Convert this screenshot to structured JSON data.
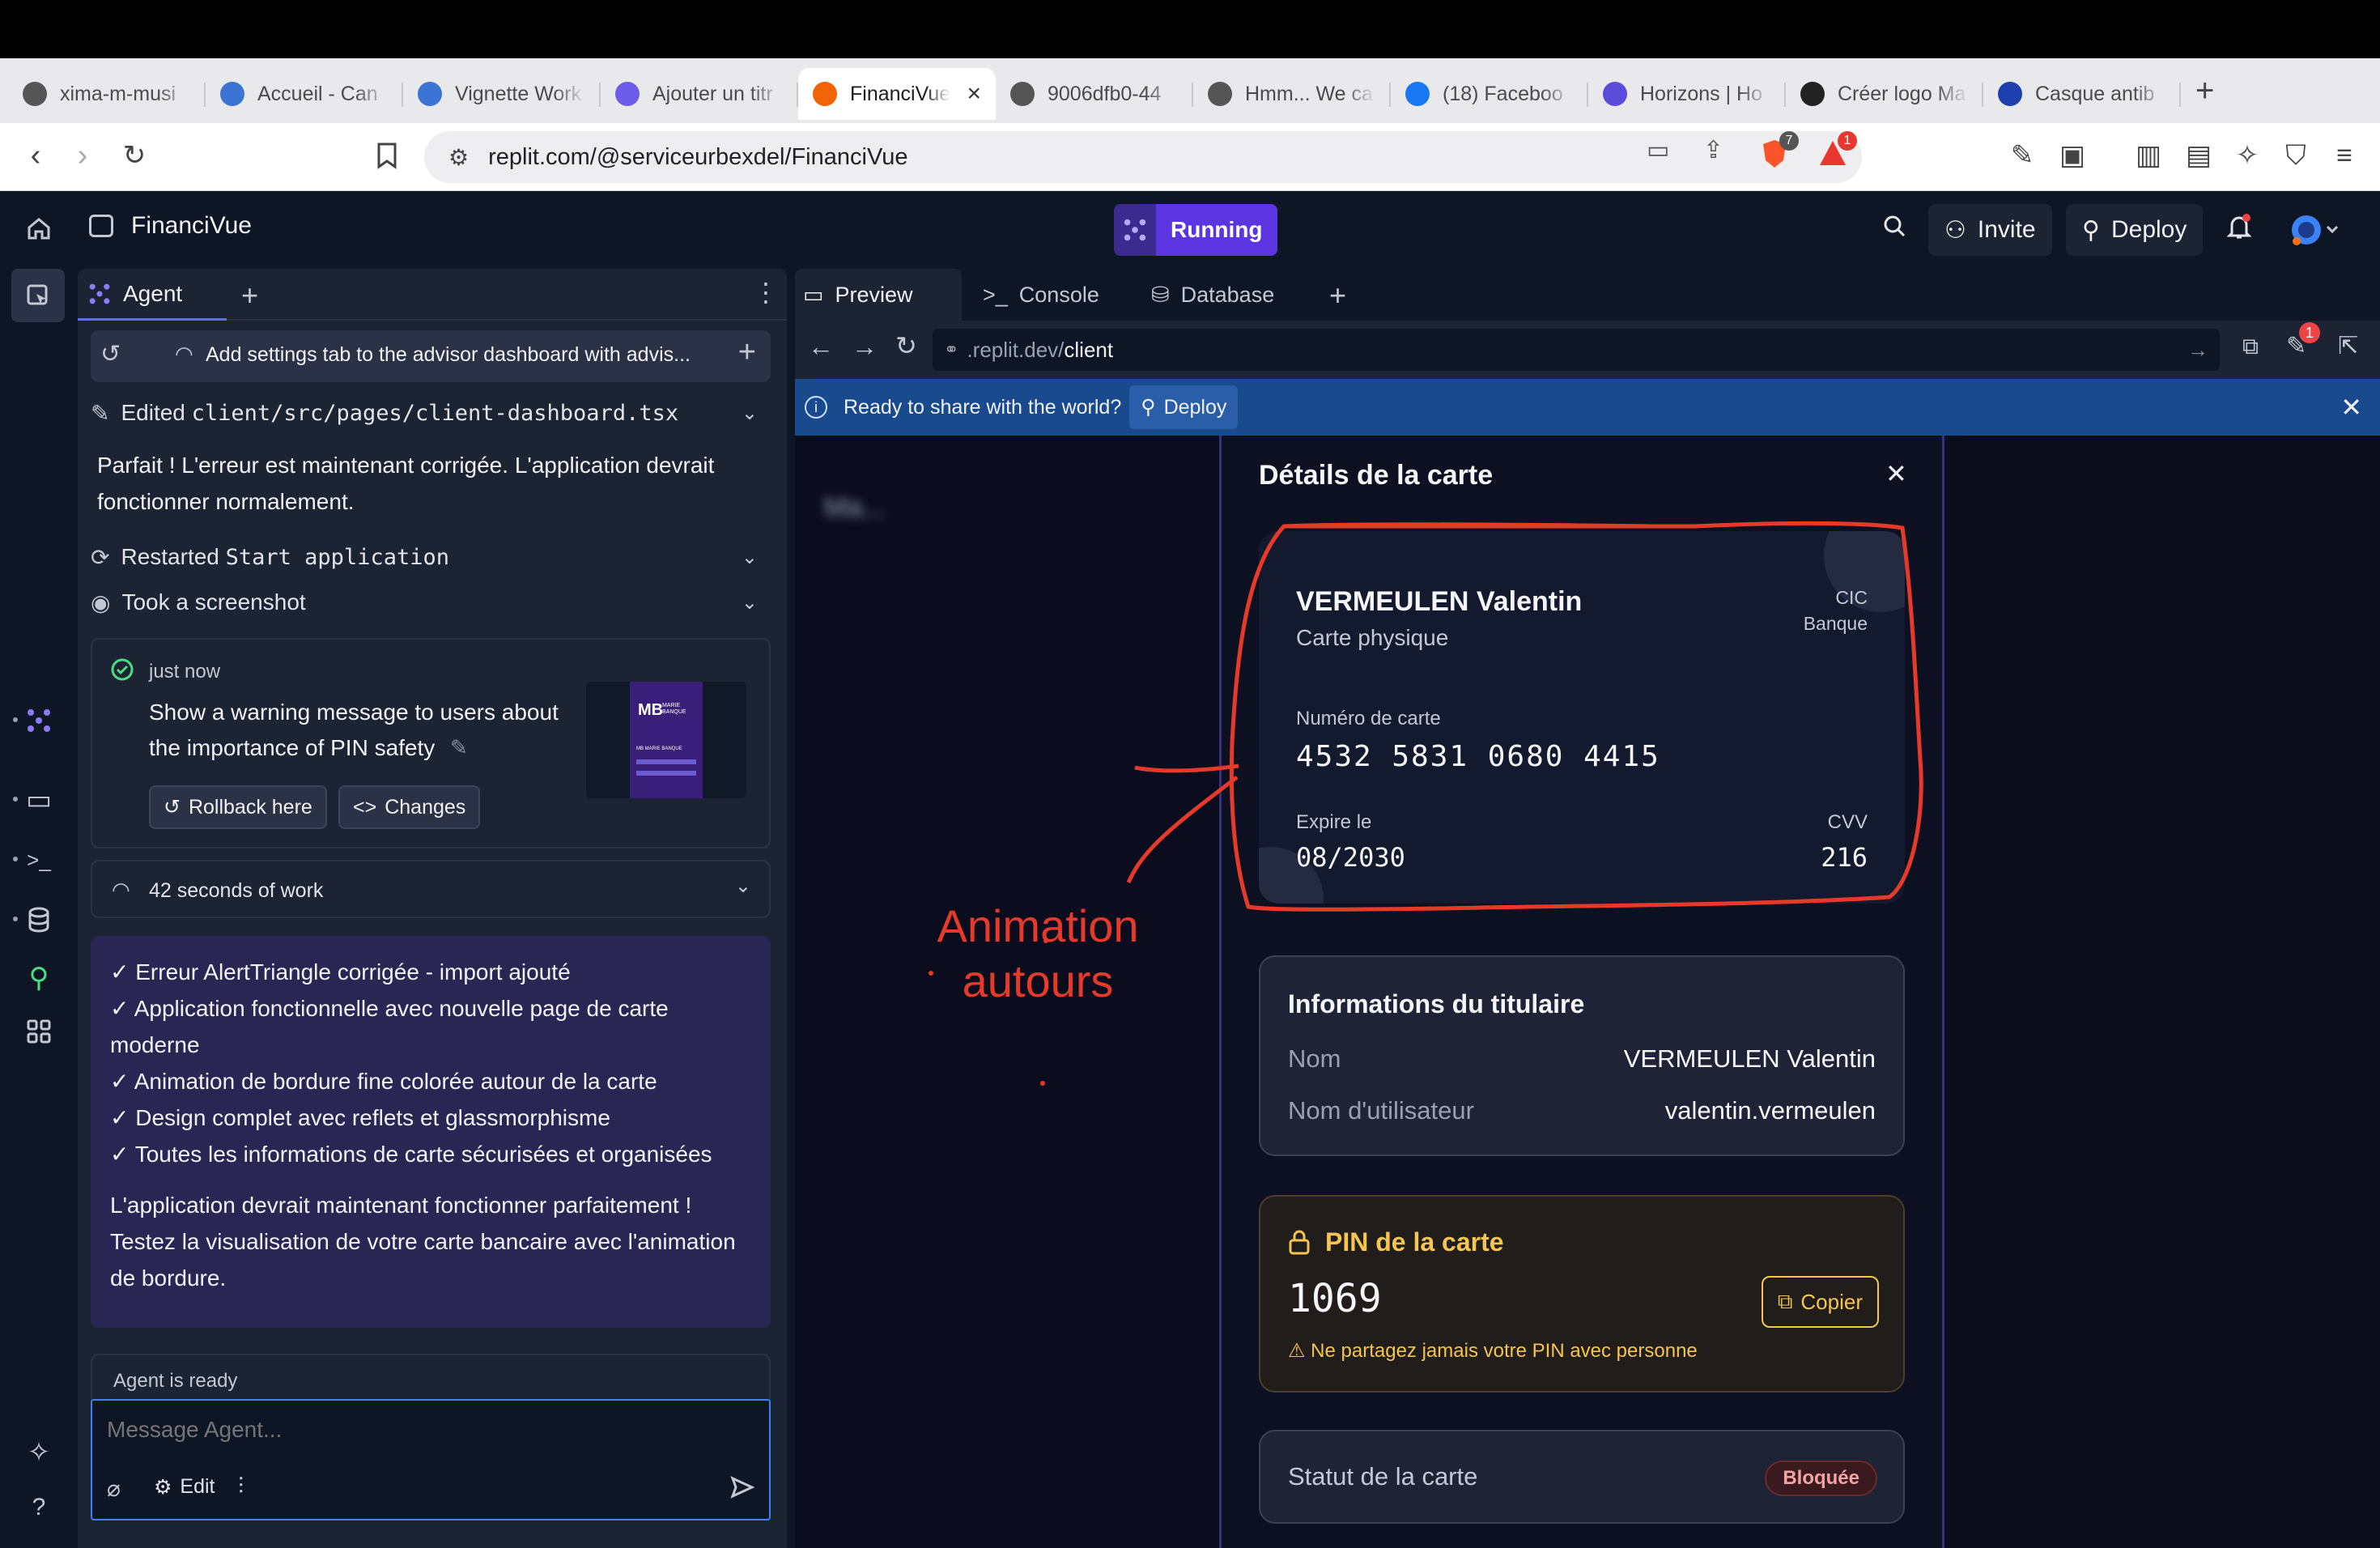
{
  "browser": {
    "tabs": [
      {
        "label": "xima-m-musi",
        "icon": "globe-icon",
        "color": "#555"
      },
      {
        "label": "Accueil - Can",
        "icon": "canva-icon",
        "color": "#3b74d4"
      },
      {
        "label": "Vignette Work",
        "icon": "canva-icon",
        "color": "#3b74d4"
      },
      {
        "label": "Ajouter un titr",
        "icon": "badge-icon",
        "color": "#6c5ce7"
      },
      {
        "label": "FinanciVue",
        "icon": "replit-icon",
        "color": "#f26207",
        "active": true
      },
      {
        "label": "9006dfb0-44",
        "icon": "globe-icon",
        "color": "#555"
      },
      {
        "label": "Hmm... We ca",
        "icon": "globe-icon",
        "color": "#555"
      },
      {
        "label": "(18) Faceboo",
        "icon": "facebook-icon",
        "color": "#1877f2"
      },
      {
        "label": "Horizons | Ho",
        "icon": "horizons-icon",
        "color": "#5b4bdb"
      },
      {
        "label": "Créer logo Ma",
        "icon": "openai-icon",
        "color": "#222"
      },
      {
        "label": "Casque antib",
        "icon": "brand-a-icon",
        "color": "#1e40af"
      }
    ],
    "url": "replit.com/@serviceurbexdel/FinanciVue",
    "brave_badge": "7",
    "rewards_badge": "1"
  },
  "topbar": {
    "project": "FinanciVue",
    "status": "Running",
    "invite": "Invite",
    "deploy": "Deploy"
  },
  "agent": {
    "tab_label": "Agent",
    "task_title": "Add settings tab to the advisor dashboard with advis...",
    "edited_prefix": "Edited ",
    "edited_file": "client/src/pages/client-dashboard.tsx",
    "message": "Parfait ! L'erreur est maintenant corrigée. L'application devrait fonctionner normalement.",
    "restarted_prefix": "Restarted ",
    "restarted_name": "Start application",
    "screenshot": "Took a screenshot",
    "checkpoint": {
      "time": "just now",
      "text": "Show a warning message to users about the importance of PIN safety",
      "rollback": "Rollback here",
      "changes": "Changes",
      "thumb_brand": "MB",
      "thumb_brand_text": "MARIE BANQUE",
      "thumb_title": "MB MARIE BANQUE"
    },
    "work_time": "42 seconds of work",
    "summary_items": [
      "✓ Erreur AlertTriangle corrigée - import ajouté",
      "✓ Application fonctionnelle avec nouvelle page de carte moderne",
      "✓ Animation de bordure fine colorée autour de la carte",
      "✓ Design complet avec reflets et glassmorphisme",
      "✓ Toutes les informations de carte sécurisées et organisées"
    ],
    "summary_footer": "L'application devrait maintenant fonctionner parfaitement ! Testez la visualisation de votre carte bancaire avec l'animation de bordure.",
    "status": "Agent is ready",
    "input_placeholder": "Message Agent...",
    "edit_label": "Edit"
  },
  "preview": {
    "tabs": [
      "Preview",
      "Console",
      "Database"
    ],
    "url_prefix": ".replit.dev/",
    "url_path": "client",
    "devtools_badge": "1",
    "banner_text": "Ready to share with the world?",
    "banner_button": "Deploy",
    "blurred_text": "Ma...",
    "annotation": [
      "Animation",
      "autours"
    ]
  },
  "modal": {
    "title": "Détails de la carte",
    "card": {
      "holder": "VERMEULEN Valentin",
      "type": "Carte physique",
      "bank_line1": "CIC",
      "bank_line2": "Banque",
      "number_label": "Numéro de carte",
      "number": "4532 5831 0680 4415",
      "expiry_label": "Expire le",
      "expiry": "08/2030",
      "cvv_label": "CVV",
      "cvv": "216"
    },
    "holder_info": {
      "title": "Informations du titulaire",
      "name_label": "Nom",
      "name_value": "VERMEULEN Valentin",
      "username_label": "Nom d'utilisateur",
      "username_value": "valentin.vermeulen"
    },
    "pin": {
      "title": "PIN de la carte",
      "value": "1069",
      "copy": "Copier",
      "warning": "⚠ Ne partagez jamais votre PIN avec personne"
    },
    "status": {
      "label": "Statut de la carte",
      "badge": "Bloquée"
    }
  },
  "colors": {
    "accent": "#5b36e0",
    "annotation_red": "#e53a2a",
    "pin_gold": "#f5c451",
    "badge_red": "#f3a3a3"
  }
}
